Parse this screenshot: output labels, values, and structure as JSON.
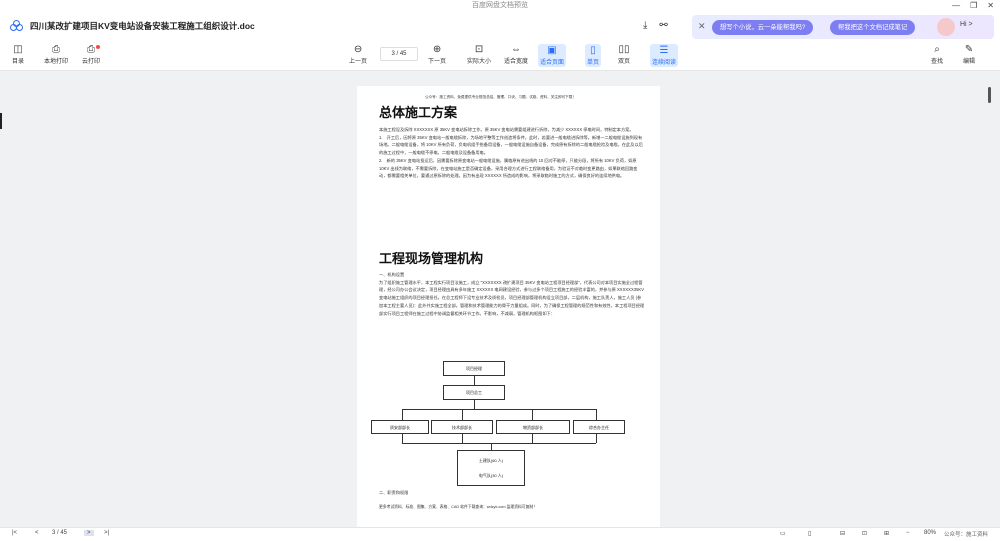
{
  "window": {
    "title": "百度网盘文档预览",
    "controls": [
      "—",
      "❐",
      "✕"
    ]
  },
  "document": {
    "title": "四川某改扩建项目KV变电站设备安装工程施工组织设计.doc"
  },
  "ai": {
    "close": "✕",
    "prompt1": "想写个小说，云一朵能帮我吗?",
    "prompt2": "帮我把这个文档记成笔记",
    "hi": "Hi >"
  },
  "toolbar": {
    "catalog": "目录",
    "local_print": "本地打印",
    "cloud_print": "云打印",
    "prev": "上一页",
    "page_indicator": "3 / 45",
    "next": "下一页",
    "actual_size": "实际大小",
    "fit_width": "适合宽度",
    "fit_page": "适合页面",
    "single": "单页",
    "double": "双页",
    "continuous": "连续阅读",
    "find": "查找",
    "edit": "编辑"
  },
  "page": {
    "header": "公众号：施工资料，免费提供专业规范总结、管理、口诀、习题、试卷、资料，关注即可下载！",
    "h1": "总体施工方案",
    "para1": "本施工程设及拆除 XXXXXXX 原 35KV 变电站拆除工作。原 35KV 变电站需要组建进行折除，为减少 XXXXXX 停电时间，特制定本方案。\n1.　开工后，因将原 35KV 变电站一般电缆拆除，为场地平整等工作创造将条件。此时，若要进一般电缆进拆除等。新增一二般电缆设施到现有场地。二般电缆设备，将 10KV 所有负荷，负电机组手抬备用设备，一般电缆设施自备设备，完成原有拆除的二般电缆抢险及电缆，在此及以后的施工过程中，一般电缆不停电，二般电缆及设备备用电。\n2.　新的 35KV 变电站投运后，因需要拆除原变电站一般电缆设施，属临原有进出线的 10 回对不能停，只能分段，将所有 10KV 负荷，如原 10KV 出线为联络，不需要拆除，在变电站施工是否确定设备，采用合理方式进行工程联络备用，为验证不对临时变更路由，如果联络回路变动，都需要相关单位，要通过原拆除的处理。因为有出现 XXXXXX 所造成的影响，将采取临时施工的方式，确保良好的连续地供电。",
    "h2": "工程现场管理机构",
    "para2": "一、机构设置\n为了组织施工管理水平，本工程实行项目法施工，成立 \"XXXXXXX 改扩建项目 35KV 变电站工程项目经理部\"，代表公司对本项目实施全过程管理，经公司办公会议决定，项目经理由具有多年施工 XXXXXX 电网建设经验，参与过多个项目工程施工的经验丰富的，并参与原 XXXXXX35KV 变电站施工组织的项目经理担任。在总工程师下设专业技术及质检员，项目经理部管理机构设立项目部，二层机构，施工队责人，施工人员 (参加本工程主要人员)：此外共实施工程全部。管理和技术管理能力的骨干力量组成。同时，为了确保工程管理的规范性和有效性，本工程项目经理部实行项目工程师在施工过程中协调监督相关环节工作。不影响，不减弱，管理机构框图如下：",
    "org": {
      "manager": "项目经理",
      "chief": "项目总工",
      "dept1": "质安部部长",
      "dept2": "技术部部长",
      "dept3": "物资部部长",
      "dept4": "综合办主任",
      "team1": "土建队(60 人)",
      "team2": "电气队(30 人)"
    },
    "section2": "二、职责和权限",
    "footer": "更多考试资料、标准、图集、方案、表格、CAD 软件下载查询：wdzyk.com 监理资料可复制！"
  },
  "status": {
    "page": "3 / 45",
    "zoom": "80%",
    "watermark": "公众号：施工资料"
  }
}
